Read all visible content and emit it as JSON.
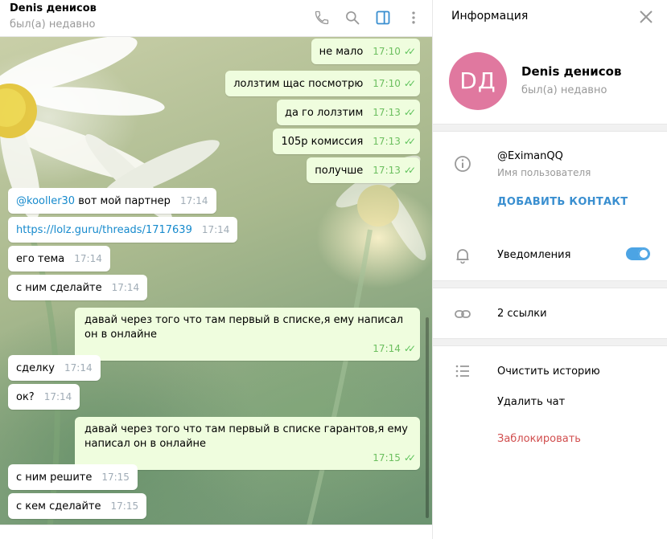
{
  "chat": {
    "title": "Denis денисов",
    "status": "был(а) недавно"
  },
  "header_icons": [
    "phone-icon",
    "search-icon",
    "sidebar-toggle-icon",
    "more-vertical-icon"
  ],
  "messages": [
    {
      "dir": "out",
      "text": "не мало",
      "time": "17:10",
      "read": true
    },
    {
      "dir": "out",
      "text": "лолзтим щас посмотрю",
      "time": "17:10",
      "read": true
    },
    {
      "dir": "out",
      "text": "да го лолзтим",
      "time": "17:13",
      "read": true
    },
    {
      "dir": "out",
      "text": "105р комиссия",
      "time": "17:13",
      "read": true
    },
    {
      "dir": "out",
      "text": "получше",
      "time": "17:13",
      "read": true
    },
    {
      "dir": "in",
      "mention": "@kooller30",
      "text": " вот мой партнер",
      "time": "17:14"
    },
    {
      "dir": "in",
      "link": "https://lolz.guru/threads/1717639",
      "time": "17:14"
    },
    {
      "dir": "in",
      "text": "его тема",
      "time": "17:14"
    },
    {
      "dir": "in",
      "text": "с ним сделайте",
      "time": "17:14"
    },
    {
      "dir": "out",
      "text": "давай через того что там первый в списке,я ему написал он в онлайне",
      "time": "17:14",
      "read": true
    },
    {
      "dir": "in",
      "text": "сделку",
      "time": "17:14"
    },
    {
      "dir": "in",
      "text": "ок?",
      "time": "17:14"
    },
    {
      "dir": "out",
      "text": "давай через того что там первый в списке гарантов,я ему написал он в онлайне",
      "time": "17:15",
      "read": true
    },
    {
      "dir": "in",
      "text": "с ним решите",
      "time": "17:15"
    },
    {
      "dir": "in",
      "text": "с кем сделайте",
      "time": "17:15"
    }
  ],
  "checkmark": "✓✓",
  "info": {
    "title": "Информация",
    "avatar_initials": "DД",
    "avatar_color": "#e0789f",
    "name": "Denis денисов",
    "status": "был(а) недавно",
    "username": "@EximanQQ",
    "username_label": "Имя пользователя",
    "add_contact": "ДОБАВИТЬ КОНТАКТ",
    "notifications": "Уведомления",
    "notifications_on": true,
    "links": "2 ссылки",
    "clear_history": "Очистить историю",
    "delete_chat": "Удалить чат",
    "block": "Заблокировать"
  },
  "colors": {
    "accent": "#4ca4e4",
    "outgoing_bubble": "#effdde",
    "danger": "#d14e4e"
  }
}
